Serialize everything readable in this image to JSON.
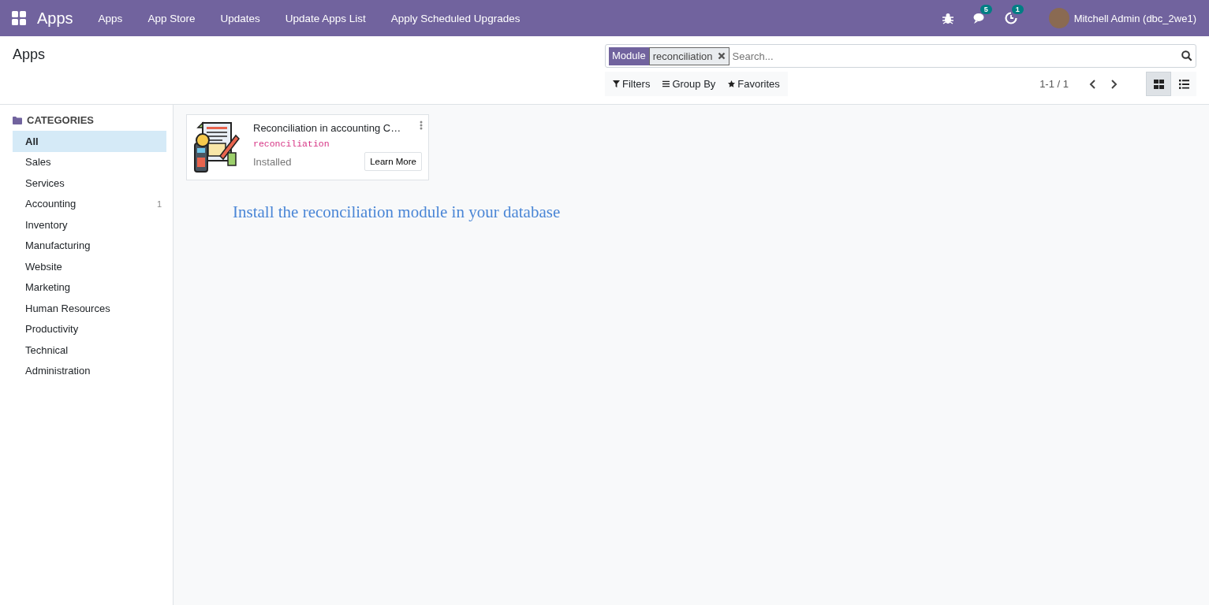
{
  "navbar": {
    "app_name": "Apps",
    "menu": [
      "Apps",
      "App Store",
      "Updates",
      "Update Apps List",
      "Apply Scheduled Upgrades"
    ],
    "systray": [
      {
        "kind": "bug"
      },
      {
        "kind": "chat",
        "badge": "5"
      },
      {
        "kind": "activity",
        "badge": "1"
      }
    ],
    "user": "Mitchell Admin (dbc_2we1)"
  },
  "control_panel": {
    "title": "Apps",
    "search": {
      "facet_label": "Module",
      "facet_value": "reconciliation",
      "placeholder": "Search..."
    },
    "buttons": [
      {
        "kind": "filter",
        "label": "Filters"
      },
      {
        "kind": "group",
        "label": "Group By"
      },
      {
        "kind": "star",
        "label": "Favorites"
      }
    ],
    "pager": "1-1 / 1",
    "views": [
      {
        "kind": "kanban",
        "selected": true
      },
      {
        "kind": "list",
        "selected": false
      }
    ]
  },
  "sidebar": {
    "heading": "CATEGORIES",
    "items": [
      {
        "label": "All",
        "selected": true
      },
      {
        "label": "Sales",
        "selected": false
      },
      {
        "label": "Services",
        "selected": false
      },
      {
        "label": "Accounting",
        "count": "1",
        "selected": false
      },
      {
        "label": "Inventory",
        "selected": false
      },
      {
        "label": "Manufacturing",
        "selected": false
      },
      {
        "label": "Website",
        "selected": false
      },
      {
        "label": "Marketing",
        "selected": false
      },
      {
        "label": "Human Resources",
        "selected": false
      },
      {
        "label": "Productivity",
        "selected": false
      },
      {
        "label": "Technical",
        "selected": false
      },
      {
        "label": "Administration",
        "selected": false
      }
    ]
  },
  "cards": [
    {
      "title": "Reconciliation in accounting C…",
      "technical_name": "reconciliation",
      "status": "Installed",
      "button": "Learn More"
    }
  ],
  "note": "Install the reconciliation module in your database"
}
